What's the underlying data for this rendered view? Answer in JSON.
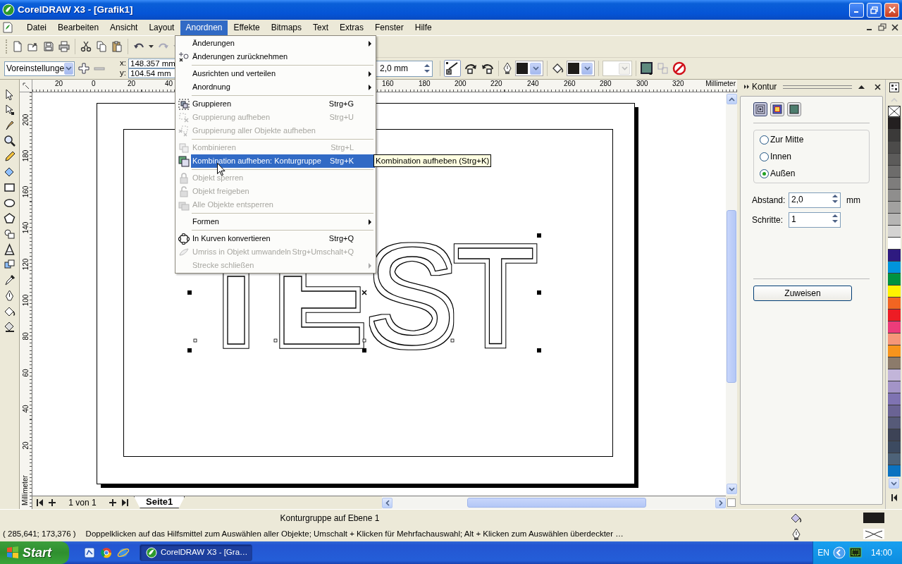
{
  "window": {
    "title": "CorelDRAW X3 - [Grafik1]"
  },
  "menu_bar": [
    {
      "label": "Datei",
      "selected": false
    },
    {
      "label": "Bearbeiten",
      "selected": false
    },
    {
      "label": "Ansicht",
      "selected": false
    },
    {
      "label": "Layout",
      "selected": false
    },
    {
      "label": "Anordnen",
      "selected": true
    },
    {
      "label": "Effekte",
      "selected": false
    },
    {
      "label": "Bitmaps",
      "selected": false
    },
    {
      "label": "Text",
      "selected": false
    },
    {
      "label": "Extras",
      "selected": false
    },
    {
      "label": "Fenster",
      "selected": false
    },
    {
      "label": "Hilfe",
      "selected": false
    }
  ],
  "property_bar": {
    "preset": "Voreinstellunge",
    "x_label": "x:",
    "x": "148.357 mm",
    "y_label": "y:",
    "y": "104.54 mm",
    "offset": "2,0 mm"
  },
  "rulers": {
    "horizontal": [
      "20",
      "0",
      "20",
      "40",
      "160",
      "180",
      "200",
      "220",
      "240",
      "260",
      "280",
      "300",
      "320"
    ],
    "horizontal_unit": "Millimeter",
    "vertical": [
      "200",
      "180",
      "160",
      "140",
      "120",
      "100",
      "80",
      "60",
      "40",
      "20"
    ],
    "vertical_unit": "Millimeter"
  },
  "canvas": {
    "object_text": "ST"
  },
  "open_menu": {
    "items": [
      {
        "kind": "item",
        "label": "Änderungen",
        "disabled": false,
        "selected": false,
        "submenu": true
      },
      {
        "kind": "item",
        "label": "Änderungen zurücknehmen",
        "disabled": false,
        "selected": false,
        "submenu": false
      },
      {
        "kind": "separator"
      },
      {
        "kind": "item",
        "label": "Ausrichten und verteilen",
        "disabled": false,
        "selected": false,
        "submenu": true
      },
      {
        "kind": "item",
        "label": "Anordnung",
        "disabled": false,
        "selected": false,
        "submenu": true
      },
      {
        "kind": "separator"
      },
      {
        "kind": "item",
        "label": "Gruppieren",
        "shortcut": "Strg+G",
        "disabled": false,
        "selected": false,
        "submenu": false
      },
      {
        "kind": "item",
        "label": "Gruppierung aufheben",
        "shortcut": "Strg+U",
        "disabled": true,
        "selected": false,
        "submenu": false
      },
      {
        "kind": "item",
        "label": "Gruppierung aller Objekte aufheben",
        "disabled": true,
        "selected": false,
        "submenu": false
      },
      {
        "kind": "separator"
      },
      {
        "kind": "item",
        "label": "Kombinieren",
        "shortcut": "Strg+L",
        "disabled": true,
        "selected": false,
        "submenu": false
      },
      {
        "kind": "item",
        "label": "Kombination aufheben: Konturgruppe",
        "shortcut": "Strg+K",
        "disabled": false,
        "selected": true,
        "submenu": false
      },
      {
        "kind": "separator"
      },
      {
        "kind": "item",
        "label": "Objekt sperren",
        "disabled": true,
        "selected": false,
        "submenu": false
      },
      {
        "kind": "item",
        "label": "Objekt freigeben",
        "disabled": true,
        "selected": false,
        "submenu": false
      },
      {
        "kind": "item",
        "label": "Alle Objekte entsperren",
        "disabled": true,
        "selected": false,
        "submenu": false
      },
      {
        "kind": "separator"
      },
      {
        "kind": "item",
        "label": "Formen",
        "disabled": false,
        "selected": false,
        "submenu": true
      },
      {
        "kind": "separator"
      },
      {
        "kind": "item",
        "label": "In Kurven konvertieren",
        "shortcut": "Strg+Q",
        "disabled": false,
        "selected": false,
        "submenu": false
      },
      {
        "kind": "item",
        "label": "Umriss in Objekt umwandeln",
        "shortcut": "Strg+Umschalt+Q",
        "disabled": true,
        "selected": false,
        "submenu": false
      },
      {
        "kind": "item",
        "label": "Strecke schließen",
        "disabled": true,
        "selected": false,
        "submenu": true
      }
    ]
  },
  "tooltip": "Kombination aufheben (Strg+K)",
  "page_nav": {
    "counter": "1 von 1",
    "tabs": [
      {
        "label": "Seite1",
        "selected": true
      }
    ]
  },
  "docker": {
    "title": "Kontur",
    "modes": [
      {
        "selected": true
      },
      {
        "selected": false
      },
      {
        "selected": false
      }
    ],
    "options": [
      {
        "label": "Zur Mitte",
        "selected": false
      },
      {
        "label": "Innen",
        "selected": false
      },
      {
        "label": "Außen",
        "selected": true
      }
    ],
    "fields": [
      {
        "label": "Abstand:",
        "value": "2,0",
        "unit": "mm"
      },
      {
        "label": "Schritte:",
        "value": "1"
      }
    ],
    "apply_button": "Zuweisen"
  },
  "palette": [
    {
      "color": "#231f20"
    },
    {
      "color": "#3b3a39"
    },
    {
      "color": "#4c4b4a"
    },
    {
      "color": "#5c5b5a"
    },
    {
      "color": "#6d6c6b"
    },
    {
      "color": "#7e7d7c"
    },
    {
      "color": "#8f8e8d"
    },
    {
      "color": "#a2a1a0"
    },
    {
      "color": "#b6b5b4"
    },
    {
      "color": "#d4d3d2"
    },
    {
      "color": "#ffffff"
    },
    {
      "color": "#2e1a80"
    },
    {
      "color": "#0094dc"
    },
    {
      "color": "#00923f"
    },
    {
      "color": "#fff200"
    },
    {
      "color": "#f26522"
    },
    {
      "color": "#ed1c24"
    },
    {
      "color": "#ec3c7a"
    },
    {
      "color": "#f69679"
    },
    {
      "color": "#f7941d"
    },
    {
      "color": "#8c7b6b"
    },
    {
      "color": "#c2b5d9"
    },
    {
      "color": "#a394c7"
    },
    {
      "color": "#7f73b2"
    },
    {
      "color": "#6a6394"
    },
    {
      "color": "#565a78"
    },
    {
      "color": "#3d4356"
    },
    {
      "color": "#3c4a60"
    },
    {
      "color": "#4d6278"
    },
    {
      "color": "#0b72c0"
    }
  ],
  "status_bar": {
    "object_info": "Konturgruppe auf Ebene 1",
    "coordinates": "( 285,641; 173,376 )",
    "hint": "Doppelklicken auf das Hilfsmittel zum Auswählen aller Objekte; Umschalt + Klicken für Mehrfachauswahl; Alt + Klicken zum Auswählen überdeckter …"
  },
  "taskbar": {
    "start": "Start",
    "tasks": [
      {
        "label": "CorelDRAW X3 - [Gra…",
        "selected": true
      }
    ],
    "language": "EN",
    "clock": "14:00"
  }
}
